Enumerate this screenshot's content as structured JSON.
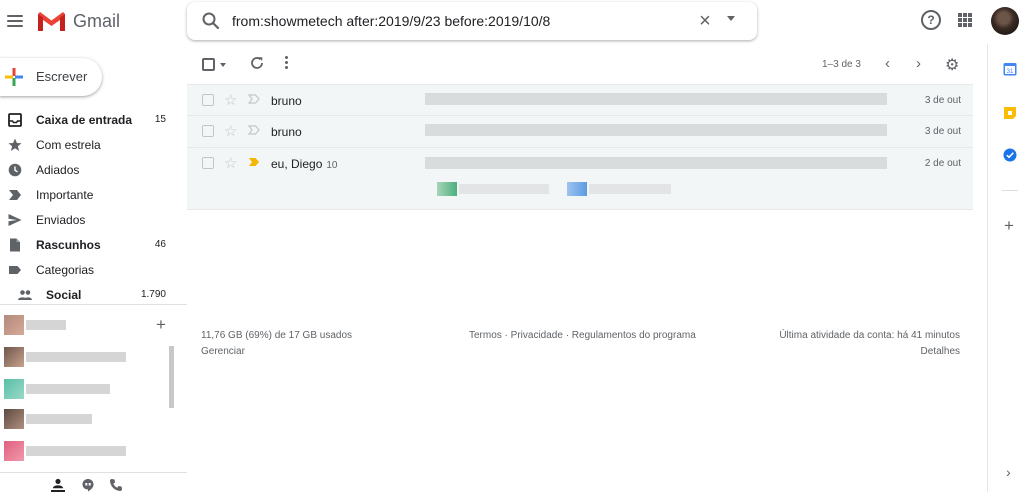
{
  "header": {
    "logo_text": "Gmail",
    "search_query": "from:showmetech after:2019/9/23 before:2019/10/8",
    "clear_glyph": "×",
    "help_glyph": "?"
  },
  "sidebar": {
    "compose_label": "Escrever",
    "items": [
      {
        "label": "Caixa de entrada",
        "count": "15",
        "icon": "inbox-icon",
        "bold": true
      },
      {
        "label": "Com estrela",
        "count": "",
        "icon": "star-icon",
        "bold": false
      },
      {
        "label": "Adiados",
        "count": "",
        "icon": "clock-icon",
        "bold": false
      },
      {
        "label": "Importante",
        "count": "",
        "icon": "important-icon",
        "bold": false
      },
      {
        "label": "Enviados",
        "count": "",
        "icon": "send-icon",
        "bold": false
      },
      {
        "label": "Rascunhos",
        "count": "46",
        "icon": "draft-icon",
        "bold": true
      },
      {
        "label": "Categorias",
        "count": "",
        "icon": "label-icon",
        "bold": false
      },
      {
        "label": "Social",
        "count": "1.790",
        "icon": "people-icon",
        "bold": true
      }
    ],
    "hangouts_add": "+"
  },
  "toolbar": {
    "range": "1–3 de 3",
    "prev_glyph": "‹",
    "next_glyph": "›",
    "gear_glyph": "⚙"
  },
  "emails": [
    {
      "sender": "bruno",
      "count": "",
      "date": "3 de out",
      "important": false
    },
    {
      "sender": "bruno",
      "count": "",
      "date": "3 de out",
      "important": false
    },
    {
      "sender": "eu, Diego",
      "count": "10",
      "date": "2 de out",
      "important": true
    }
  ],
  "footer": {
    "storage": "11,76 GB (69%) de 17 GB usados",
    "manage": "Gerenciar",
    "terms": "Termos · Privacidade · Regulamentos do programa",
    "activity": "Última atividade da conta: há 41 minutos",
    "details": "Detalhes"
  },
  "colors": {
    "accent_red": "#ea4335",
    "important_yellow": "#f4b400",
    "calendar_blue": "#4285f4",
    "keep_yellow": "#fbbc04",
    "tasks_blue": "#1a73e8"
  }
}
